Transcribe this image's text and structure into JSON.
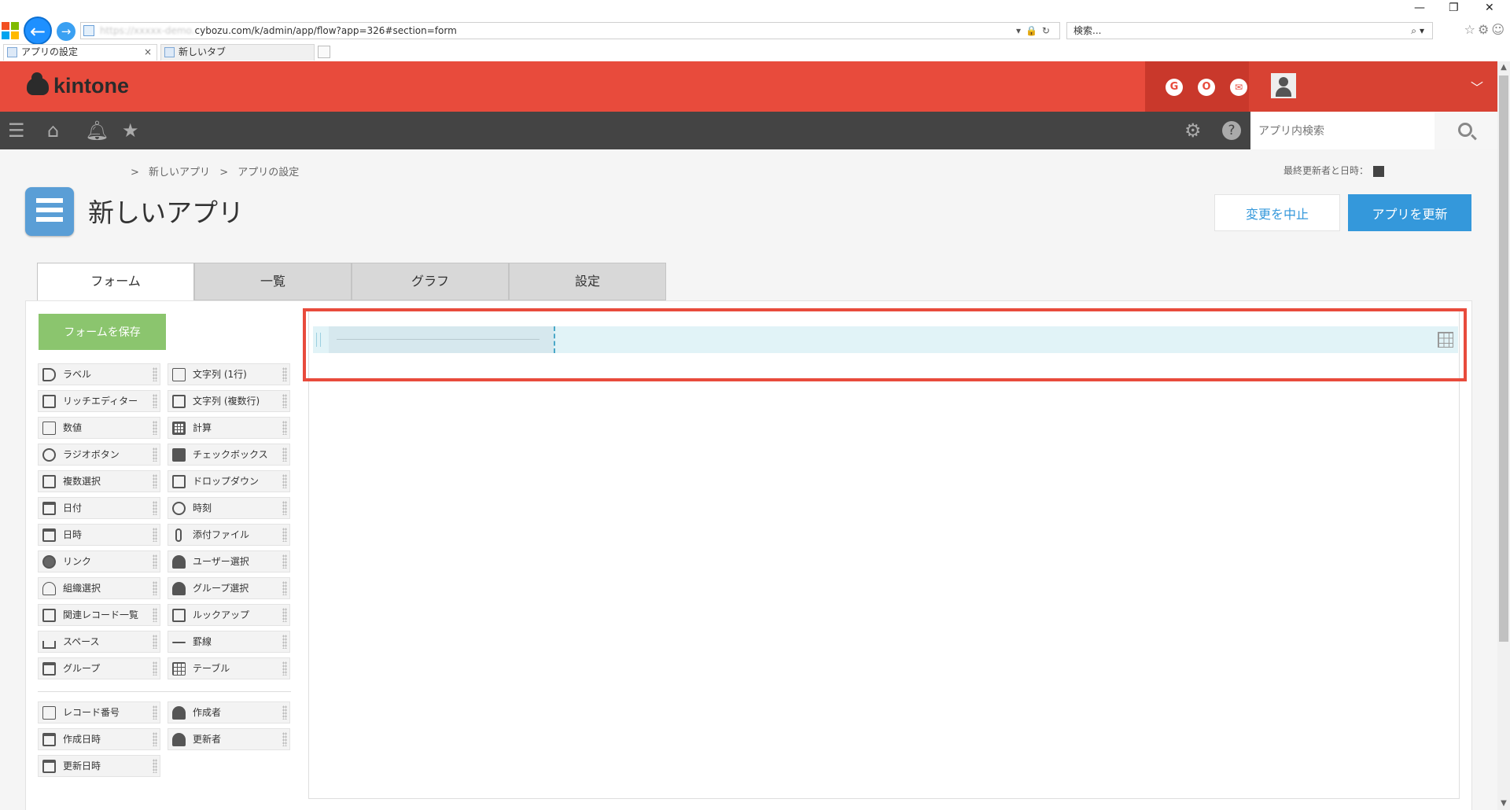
{
  "browser": {
    "url_blurred": "https://xxxxx-demo.",
    "url": "cybozu.com/k/admin/app/flow?app=326#section=form",
    "search_placeholder": "検索...",
    "tabs": [
      {
        "label": "アプリの設定",
        "close": "×"
      },
      {
        "label": "新しいタブ"
      }
    ],
    "window_controls": {
      "minimize": "—",
      "restore": "❐",
      "close": "✕"
    }
  },
  "header": {
    "logo_text": "kintone",
    "icons": [
      "G",
      "O",
      "✉"
    ]
  },
  "nav": {
    "search_placeholder": "アプリ内検索"
  },
  "page": {
    "breadcrumb": [
      ">",
      "新しいアプリ",
      ">",
      "アプリの設定"
    ],
    "last_updated_label": "最終更新者と日時：",
    "title": "新しいアプリ",
    "cancel_label": "変更を中止",
    "update_label": "アプリを更新",
    "tabs": [
      "フォーム",
      "一覧",
      "グラフ",
      "設定"
    ],
    "save_form_label": "フォームを保存"
  },
  "palette": {
    "left": [
      "ラベル",
      "リッチエディター",
      "数値",
      "ラジオボタン",
      "複数選択",
      "日付",
      "日時",
      "リンク",
      "組織選択",
      "関連レコード一覧",
      "スペース",
      "グループ"
    ],
    "right": [
      "文字列 (1行)",
      "文字列 (複数行)",
      "計算",
      "チェックボックス",
      "ドロップダウン",
      "時刻",
      "添付ファイル",
      "ユーザー選択",
      "グループ選択",
      "ルックアップ",
      "罫線",
      "テーブル"
    ],
    "system_left": [
      "レコード番号",
      "作成日時",
      "更新日時"
    ],
    "system_right": [
      "作成者",
      "更新者"
    ]
  },
  "colors": {
    "kintone_red": "#e84b3c",
    "nav_dark": "#444444",
    "primary_blue": "#3498db",
    "save_green": "#8bc56e",
    "table_highlight": "#e1f3f7"
  }
}
